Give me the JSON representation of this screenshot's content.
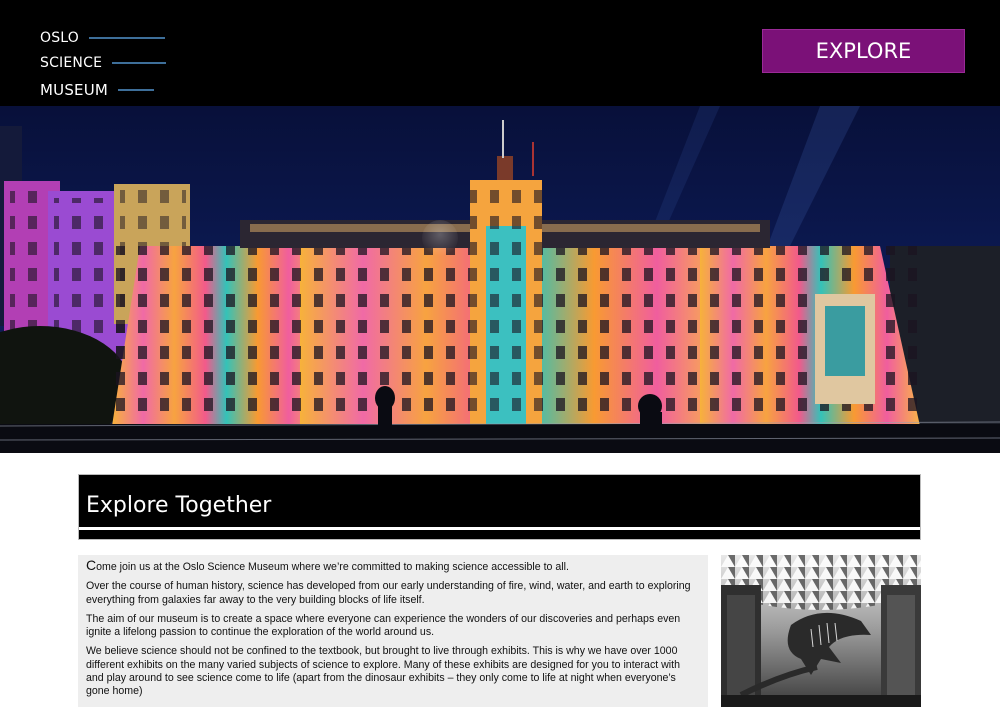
{
  "header": {
    "logo_lines": [
      "OSLO",
      "SCIENCE",
      "MUSEUM"
    ],
    "explore_label": "EXPLORE"
  },
  "colors": {
    "header_bg": "#000000",
    "button_bg": "#7b1178",
    "logo_rule": "#3e6f9a",
    "panel_bg": "#eeeeee"
  },
  "hero": {
    "image_icon": "museum-facade-light-projection-photo"
  },
  "section": {
    "title": "Explore Together"
  },
  "intro": {
    "dropcap": "C",
    "p1_rest": "ome join us at the Oslo Science Museum where we’re committed to making science accessible to all.",
    "p2": "Over the course of human history, science has developed from our early understanding of fire, wind, water, and earth to exploring everything from galaxies far away to the very building blocks of life itself.",
    "p3": "The aim of our museum is to create a space where everyone can experience the wonders of our discoveries and perhaps even ignite a lifelong passion to continue the exploration of the world around us.",
    "p4": "We believe science should not be confined to the textbook, but brought to live through exhibits. This is why we have over 1000 different exhibits on the many varied subjects of science to explore. Many of these exhibits are designed for you to interact with and play around to see science come to life (apart from the dinosaur exhibits – they only come to life at night when everyone’s gone home)"
  },
  "side_photo": {
    "image_icon": "dinosaur-skeleton-atrium-photo"
  }
}
